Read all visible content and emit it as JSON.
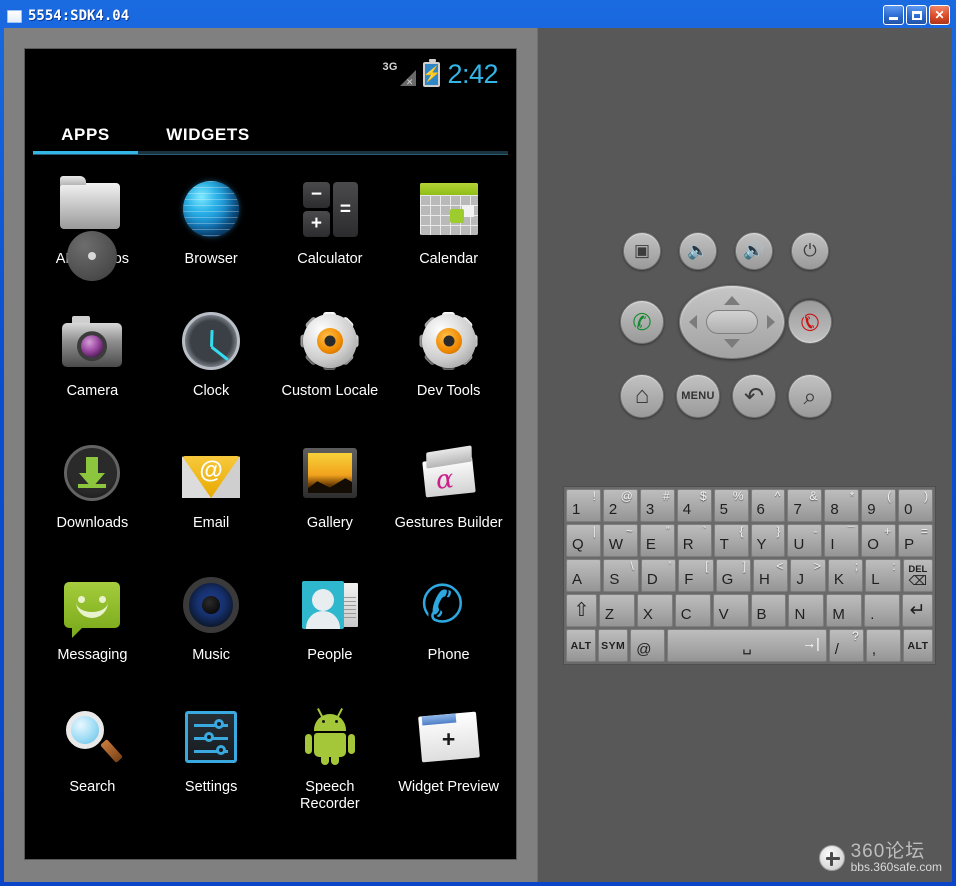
{
  "window": {
    "title": "5554:SDK4.04",
    "icon": "emulator-window-icon",
    "buttons": {
      "minimize": "minimize-button",
      "maximize": "maximize-button",
      "close": "close-button",
      "close_glyph": "✕"
    }
  },
  "screen": {
    "statusbar": {
      "network": "3G",
      "signal_state": "no-signal",
      "signal_x": "✕",
      "battery": "charging",
      "battery_glyph": "⚡",
      "time": "2:42"
    },
    "tabs": [
      {
        "label": "APPS",
        "active": true
      },
      {
        "label": "WIDGETS",
        "active": false
      }
    ],
    "accent_color": "#33b5e5",
    "apps": [
      {
        "label": "API Demos",
        "icon": "api-demos-icon"
      },
      {
        "label": "Browser",
        "icon": "browser-icon"
      },
      {
        "label": "Calculator",
        "icon": "calculator-icon"
      },
      {
        "label": "Calendar",
        "icon": "calendar-icon"
      },
      {
        "label": "Camera",
        "icon": "camera-icon"
      },
      {
        "label": "Clock",
        "icon": "clock-icon"
      },
      {
        "label": "Custom Locale",
        "icon": "custom-locale-icon"
      },
      {
        "label": "Dev Tools",
        "icon": "dev-tools-icon"
      },
      {
        "label": "Downloads",
        "icon": "downloads-icon"
      },
      {
        "label": "Email",
        "icon": "email-icon"
      },
      {
        "label": "Gallery",
        "icon": "gallery-icon"
      },
      {
        "label": "Gestures Builder",
        "icon": "gestures-builder-icon"
      },
      {
        "label": "Messaging",
        "icon": "messaging-icon"
      },
      {
        "label": "Music",
        "icon": "music-icon"
      },
      {
        "label": "People",
        "icon": "people-icon"
      },
      {
        "label": "Phone",
        "icon": "phone-icon"
      },
      {
        "label": "Search",
        "icon": "search-icon"
      },
      {
        "label": "Settings",
        "icon": "settings-icon"
      },
      {
        "label": "Speech Recorder",
        "icon": "speech-recorder-icon"
      },
      {
        "label": "Widget Preview",
        "icon": "widget-preview-icon"
      }
    ]
  },
  "hardware": {
    "camera": {
      "name": "camera-button",
      "glyph": "▣"
    },
    "volume_down": {
      "name": "volume-down-button",
      "glyph": "🔈"
    },
    "volume_up": {
      "name": "volume-up-button",
      "glyph": "🔊"
    },
    "power": {
      "name": "power-button",
      "glyph": "⏻"
    },
    "call": {
      "name": "call-button",
      "glyph": "✆",
      "color": "#138a2e"
    },
    "end_call": {
      "name": "end-call-button",
      "glyph": "✆",
      "color": "#cc1111"
    },
    "dpad": {
      "name": "dpad"
    },
    "home": {
      "name": "home-button",
      "glyph": "⌂"
    },
    "menu": {
      "name": "menu-button",
      "label": "MENU"
    },
    "back": {
      "name": "back-button",
      "glyph": "↶"
    },
    "search": {
      "name": "search-button",
      "glyph": "⌕"
    }
  },
  "keyboard": {
    "rows": [
      [
        {
          "main": "1",
          "alt": "!"
        },
        {
          "main": "2",
          "alt": "@"
        },
        {
          "main": "3",
          "alt": "#"
        },
        {
          "main": "4",
          "alt": "$"
        },
        {
          "main": "5",
          "alt": "%"
        },
        {
          "main": "6",
          "alt": "^"
        },
        {
          "main": "7",
          "alt": "&"
        },
        {
          "main": "8",
          "alt": "*"
        },
        {
          "main": "9",
          "alt": "("
        },
        {
          "main": "0",
          "alt": ")"
        }
      ],
      [
        {
          "main": "Q",
          "alt": "|"
        },
        {
          "main": "W",
          "alt": "~"
        },
        {
          "main": "E",
          "alt": "”"
        },
        {
          "main": "R",
          "alt": "`"
        },
        {
          "main": "T",
          "alt": "{"
        },
        {
          "main": "Y",
          "alt": "}"
        },
        {
          "main": "U",
          "alt": "-"
        },
        {
          "main": "I",
          "alt": "¯"
        },
        {
          "main": "O",
          "alt": "+"
        },
        {
          "main": "P",
          "alt": "="
        }
      ],
      [
        {
          "main": "A",
          "alt": ""
        },
        {
          "main": "S",
          "alt": "\\"
        },
        {
          "main": "D",
          "alt": "’"
        },
        {
          "main": "F",
          "alt": "["
        },
        {
          "main": "G",
          "alt": "]"
        },
        {
          "main": "H",
          "alt": "<"
        },
        {
          "main": "J",
          "alt": ">"
        },
        {
          "main": "K",
          "alt": ";"
        },
        {
          "main": "L",
          "alt": ":"
        },
        {
          "main": "DEL",
          "alt": "",
          "type": "del"
        }
      ],
      [
        {
          "main": "⇧",
          "alt": "",
          "type": "shift"
        },
        {
          "main": "Z",
          "alt": ""
        },
        {
          "main": "X",
          "alt": ""
        },
        {
          "main": "C",
          "alt": ""
        },
        {
          "main": "V",
          "alt": ""
        },
        {
          "main": "B",
          "alt": ""
        },
        {
          "main": "N",
          "alt": ""
        },
        {
          "main": "M",
          "alt": ""
        },
        {
          "main": ".",
          "alt": ""
        },
        {
          "main": "↵",
          "alt": "",
          "type": "enter"
        }
      ],
      [
        {
          "main": "ALT",
          "alt": "",
          "type": "mod"
        },
        {
          "main": "SYM",
          "alt": "",
          "type": "mod"
        },
        {
          "main": "@",
          "alt": ""
        },
        {
          "main": "␣",
          "alt": "→|",
          "type": "space"
        },
        {
          "main": "/",
          "alt": "?"
        },
        {
          "main": ",",
          "alt": ""
        },
        {
          "main": "ALT",
          "alt": "",
          "type": "mod"
        }
      ]
    ]
  },
  "watermark": {
    "title": "360论坛",
    "url": "bbs.360safe.com"
  }
}
